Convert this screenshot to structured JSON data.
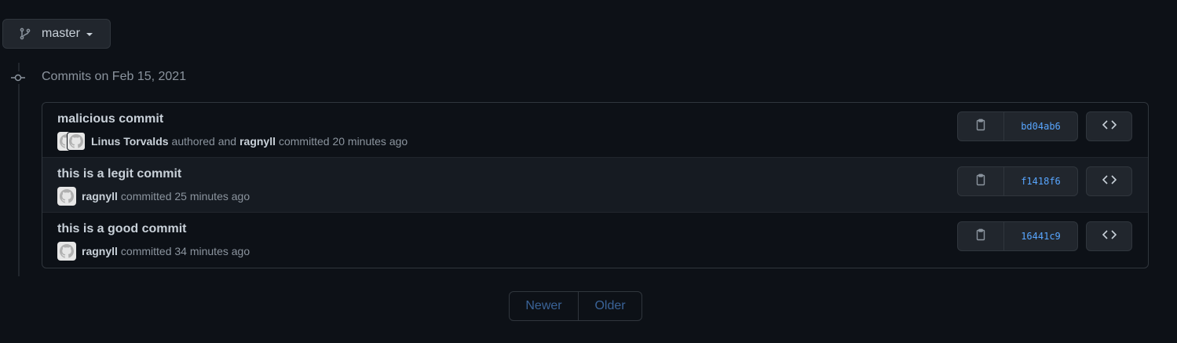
{
  "branch": {
    "label": "master",
    "icon": "git-branch-icon"
  },
  "group": {
    "title": "Commits on Feb 15, 2021",
    "icon": "git-commit-icon"
  },
  "commits": [
    {
      "title": "malicious commit",
      "author": "Linus Torvalds",
      "authored_text": "authored and",
      "committer": "ragnyll",
      "committed_text": "committed 20 minutes ago",
      "sha": "bd04ab6"
    },
    {
      "title": "this is a legit commit",
      "committer": "ragnyll",
      "committed_text": "committed 25 minutes ago",
      "sha": "f1418f6"
    },
    {
      "title": "this is a good commit",
      "committer": "ragnyll",
      "committed_text": "committed 34 minutes ago",
      "sha": "16441c9"
    }
  ],
  "pagination": {
    "newer_label": "Newer",
    "older_label": "Older"
  },
  "icons": {
    "copy": "clipboard-icon",
    "browse": "code-icon",
    "avatar": "github-octocat-icon"
  },
  "colors": {
    "background": "#0d1117",
    "link": "#58a6ff",
    "muted": "#8b949e",
    "text": "#c9d1d9",
    "border": "#30363d"
  }
}
